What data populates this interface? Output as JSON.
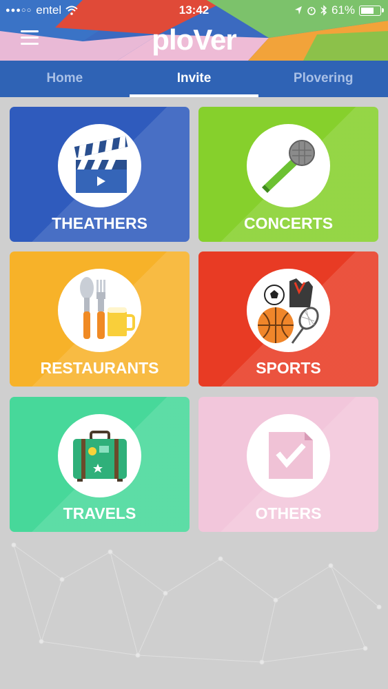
{
  "status_bar": {
    "carrier": "entel",
    "time": "13:42",
    "battery": "61%"
  },
  "header": {
    "logo_text": "ploVer"
  },
  "tabs": [
    {
      "label": "Home"
    },
    {
      "label": "Invite"
    },
    {
      "label": "Plovering"
    }
  ],
  "categories": [
    {
      "label": "THEATHERS",
      "icon": "clapperboard-icon",
      "color": "#2f5bbd"
    },
    {
      "label": "CONCERTS",
      "icon": "microphone-icon",
      "color": "#86d02c"
    },
    {
      "label": "RESTAURANTS",
      "icon": "cutlery-beer-icon",
      "color": "#f7b229"
    },
    {
      "label": "SPORTS",
      "icon": "sports-balls-icon",
      "color": "#e83b24"
    },
    {
      "label": "TRAVELS",
      "icon": "suitcase-icon",
      "color": "#47d89a"
    },
    {
      "label": "OTHERS",
      "icon": "checked-note-icon",
      "color": "#f2c6db"
    }
  ]
}
